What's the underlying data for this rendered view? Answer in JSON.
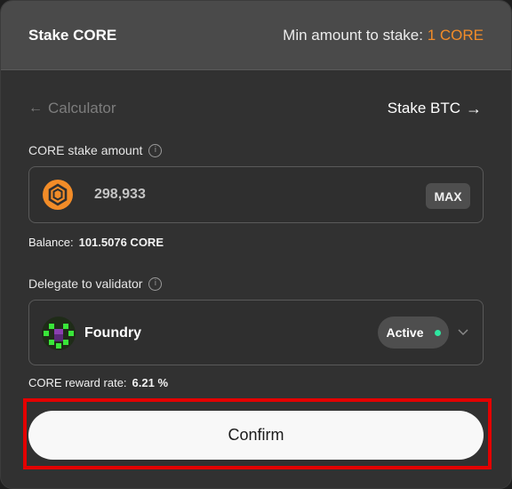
{
  "header": {
    "title": "Stake CORE",
    "min_label": "Min amount to stake: ",
    "min_value": "1 CORE"
  },
  "nav": {
    "calculator_label": "Calculator",
    "stake_btc_label": "Stake BTC"
  },
  "stake": {
    "label": "CORE stake amount",
    "amount": "298,933",
    "max_label": "MAX",
    "balance_label": "Balance:",
    "balance_value": "101.5076 CORE"
  },
  "delegate": {
    "label": "Delegate to validator",
    "validator_name": "Foundry",
    "status": "Active",
    "reward_label": "CORE reward rate:",
    "reward_value": "6.21 %"
  },
  "confirm_label": "Confirm",
  "colors": {
    "accent": "#f28c28",
    "active_dot": "#2ee6a0",
    "highlight": "#e30000"
  }
}
